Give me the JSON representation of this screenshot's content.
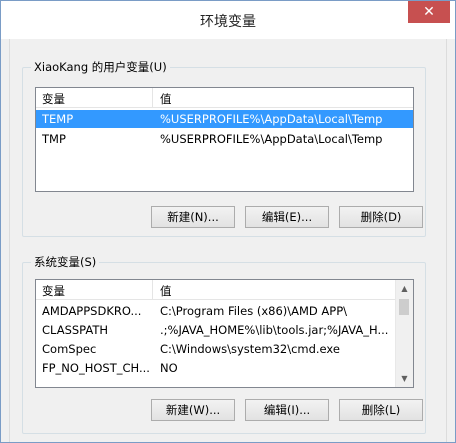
{
  "window": {
    "title": "环境变量",
    "close_glyph": "✕"
  },
  "user_vars": {
    "group_label": "XiaoKang 的用户变量(U)",
    "columns": [
      "变量",
      "值"
    ],
    "rows": [
      {
        "name": "TEMP",
        "value": "%USERPROFILE%\\AppData\\Local\\Temp",
        "selected": true
      },
      {
        "name": "TMP",
        "value": "%USERPROFILE%\\AppData\\Local\\Temp",
        "selected": false
      }
    ],
    "buttons": {
      "new": "新建(N)...",
      "edit": "编辑(E)...",
      "delete": "删除(D)"
    }
  },
  "system_vars": {
    "group_label": "系统变量(S)",
    "columns": [
      "变量",
      "值"
    ],
    "rows": [
      {
        "name": "AMDAPPSDKRO...",
        "value": "C:\\Program Files (x86)\\AMD APP\\"
      },
      {
        "name": "CLASSPATH",
        "value": ".;%JAVA_HOME%\\lib\\tools.jar;%JAVA_H..."
      },
      {
        "name": "ComSpec",
        "value": "C:\\Windows\\system32\\cmd.exe"
      },
      {
        "name": "FP_NO_HOST_CH...",
        "value": "NO"
      }
    ],
    "buttons": {
      "new": "新建(W)...",
      "edit": "编辑(I)...",
      "delete": "删除(L)"
    }
  },
  "colors": {
    "selection": "#3399ff",
    "close": "#c75050"
  }
}
